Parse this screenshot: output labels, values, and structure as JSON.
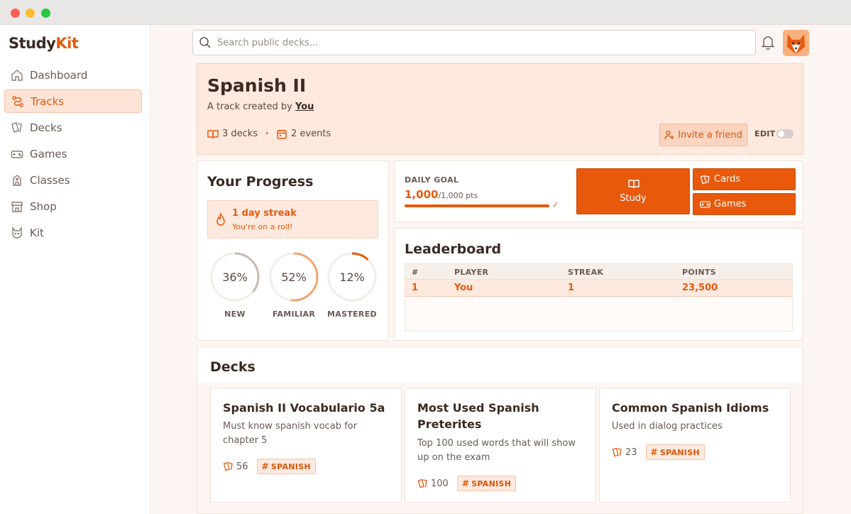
{
  "app": {
    "logo_main": "Study",
    "logo_accent": "Kit"
  },
  "sidebar": {
    "items": [
      {
        "label": "Dashboard",
        "icon": "home-icon"
      },
      {
        "label": "Tracks",
        "icon": "route-icon",
        "active": true
      },
      {
        "label": "Decks",
        "icon": "cards-icon"
      },
      {
        "label": "Games",
        "icon": "gamepad-icon"
      },
      {
        "label": "Classes",
        "icon": "school-icon"
      },
      {
        "label": "Shop",
        "icon": "store-icon"
      },
      {
        "label": "Kit",
        "icon": "cat-icon"
      }
    ]
  },
  "search": {
    "placeholder": "Search public decks..."
  },
  "track": {
    "title": "Spanish II",
    "subtitle_prefix": "A track created by",
    "owner": "You",
    "decks_count": "3 decks",
    "events_count": "2 events",
    "invite_label": "Invite a friend",
    "edit_label": "EDIT"
  },
  "progress": {
    "title": "Your Progress",
    "streak_title": "1 day streak",
    "streak_subtitle": "You're on a roll!",
    "rings": [
      {
        "pct": "36%",
        "value": 0.36,
        "label": "NEW",
        "color": "#c9bab2"
      },
      {
        "pct": "52%",
        "value": 0.52,
        "label": "FAMILIAR",
        "color": "#f4a470"
      },
      {
        "pct": "12%",
        "value": 0.12,
        "label": "MASTERED",
        "color": "#e8590c"
      }
    ]
  },
  "goal": {
    "label": "DAILY GOAL",
    "value": "1,000",
    "of": "/1,000 pts",
    "fraction": 1.0,
    "study_label": "Study",
    "cards_label": "Cards",
    "games_label": "Games"
  },
  "leaderboard": {
    "title": "Leaderboard",
    "columns": [
      "#",
      "PLAYER",
      "STREAK",
      "POINTS"
    ],
    "rows": [
      {
        "rank": "1",
        "player": "You",
        "streak": "1",
        "points": "23,500"
      }
    ]
  },
  "decks": {
    "title": "Decks",
    "items": [
      {
        "title": "Spanish II Vocabulario 5a",
        "desc": "Must know spanish vocab for chapter 5",
        "count": "56",
        "tag": "SPANISH"
      },
      {
        "title": "Most Used Spanish Preterites",
        "desc": "Top 100 used words that will show up on the exam",
        "count": "100",
        "tag": "SPANISH"
      },
      {
        "title": "Common Spanish Idioms",
        "desc": "Used in dialog practices",
        "count": "23",
        "tag": "SPANISH"
      }
    ]
  },
  "colors": {
    "accent": "#e8590c",
    "accent_light": "#fde9de",
    "text": "#3a2a22"
  }
}
